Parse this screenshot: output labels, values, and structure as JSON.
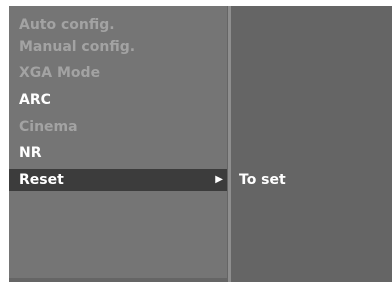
{
  "menu": {
    "items": [
      {
        "label": "Auto config.",
        "state": "disabled"
      },
      {
        "label": "Manual config.",
        "state": "disabled"
      },
      {
        "label": "XGA Mode",
        "state": "disabled"
      },
      {
        "label": "ARC",
        "state": "enabled"
      },
      {
        "label": "Cinema",
        "state": "disabled"
      },
      {
        "label": "NR",
        "state": "enabled"
      },
      {
        "label": "Reset",
        "state": "selected"
      }
    ],
    "selected_arrow": "▶"
  },
  "submenu": {
    "label": "To set"
  },
  "colors": {
    "background": "#656565",
    "menu_panel": "#757575",
    "selected_bar": "#3c3c3c",
    "disabled_text": "#a3a3a3",
    "enabled_text": "#ffffff"
  }
}
